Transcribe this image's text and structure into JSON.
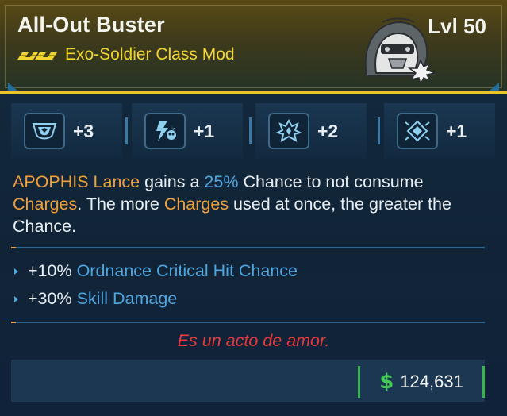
{
  "item": {
    "name": "All-Out Buster",
    "subtitle": "Exo-Soldier Class Mod",
    "level": "Lvl 50",
    "rarity_icon": "legendary-chevrons-icon",
    "emblem_icon": "exo-soldier-helmet-icon"
  },
  "skills": [
    {
      "icon": "shield-crest-icon",
      "value": "+3"
    },
    {
      "icon": "lightning-skull-icon",
      "value": "+1"
    },
    {
      "icon": "crown-emblem-icon",
      "value": "+2"
    },
    {
      "icon": "diamond-burst-icon",
      "value": "+1"
    }
  ],
  "description": {
    "p1": "APOPHIS Lance",
    "p2": " gains a ",
    "p3": "25%",
    "p4": " Chance to not consume ",
    "p5": "Charges",
    "p6": ". The more ",
    "p7": "Charges",
    "p8": " used at once, the greater the Chance."
  },
  "bonuses": [
    {
      "amount": "+10%",
      "stat": "Ordnance Critical Hit Chance"
    },
    {
      "amount": "+30%",
      "stat": "Skill Damage"
    }
  ],
  "flavor_text": "Es un acto de amor.",
  "price": {
    "icon": "dollar-icon",
    "symbol": "$",
    "value": "124,631"
  },
  "colors": {
    "accent_gold": "#e8c62a",
    "highlight_orange": "#f0a03a",
    "highlight_blue": "#4ea6e0",
    "flavor_red": "#e83a3a",
    "money_green": "#35b84a"
  }
}
